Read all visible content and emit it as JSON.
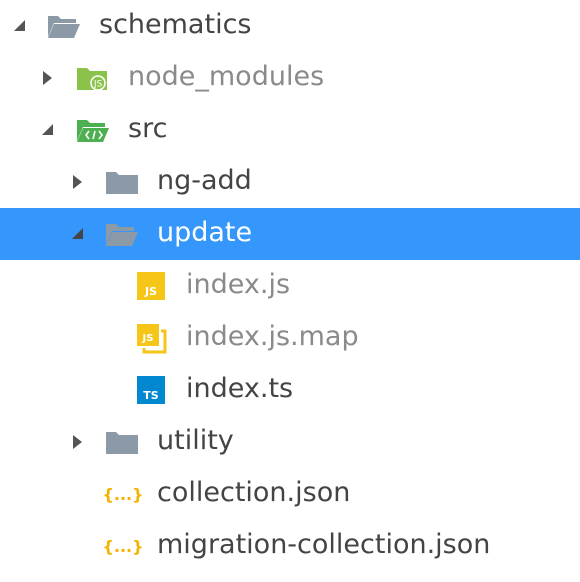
{
  "tree": {
    "selected_color": "#3597fb",
    "items": [
      {
        "label": "schematics",
        "icon": "folder-open-icon",
        "state": "expanded"
      },
      {
        "label": "node_modules",
        "icon": "folder-js-icon",
        "state": "collapsed"
      },
      {
        "label": "src",
        "icon": "folder-src-open-icon",
        "state": "expanded"
      },
      {
        "label": "ng-add",
        "icon": "folder-icon",
        "state": "collapsed"
      },
      {
        "label": "update",
        "icon": "folder-open-icon",
        "state": "expanded",
        "selected": true
      },
      {
        "label": "index.js",
        "icon": "js-file-icon",
        "badge": "JS"
      },
      {
        "label": "index.js.map",
        "icon": "js-map-file-icon",
        "badge": "JS"
      },
      {
        "label": "index.ts",
        "icon": "ts-file-icon",
        "badge": "TS"
      },
      {
        "label": "utility",
        "icon": "folder-icon",
        "state": "collapsed"
      },
      {
        "label": "collection.json",
        "icon": "json-file-icon",
        "badge": "{...}"
      },
      {
        "label": "migration-collection.json",
        "icon": "json-file-icon",
        "badge": "{...}"
      }
    ]
  }
}
